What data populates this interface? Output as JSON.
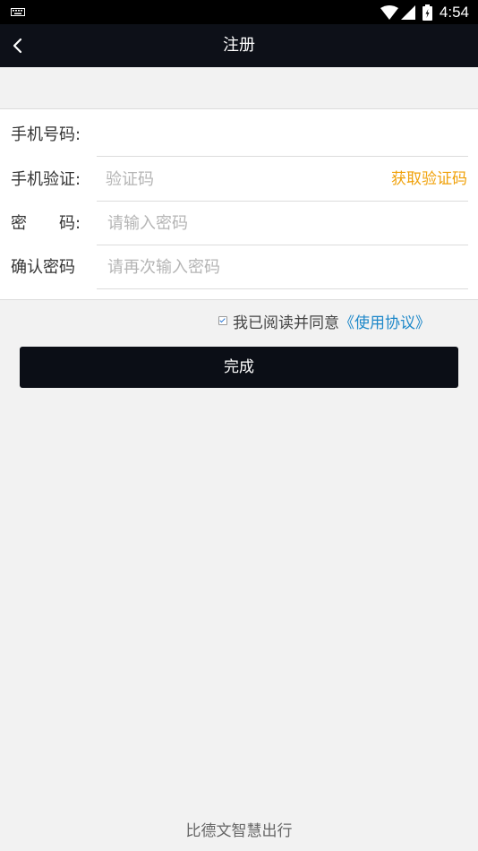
{
  "status_bar": {
    "time": "4:54"
  },
  "top_bar": {
    "title": "注册"
  },
  "form": {
    "phone": {
      "label": "手机号码:",
      "value": "",
      "placeholder": ""
    },
    "verify": {
      "label": "手机验证:",
      "placeholder": "验证码",
      "get_code_label": "获取验证码"
    },
    "password": {
      "label": "密　　码:",
      "placeholder": "请输入密码"
    },
    "confirm": {
      "label": "确认密码",
      "placeholder": "请再次输入密码"
    }
  },
  "agreement": {
    "checked": true,
    "text": "我已阅读并同意",
    "link": "《使用协议》"
  },
  "submit_label": "完成",
  "footer": "比德文智慧出行",
  "colors": {
    "dark": "#0d1018",
    "accent_orange": "#f0a10a",
    "link_blue": "#1e88c9"
  }
}
